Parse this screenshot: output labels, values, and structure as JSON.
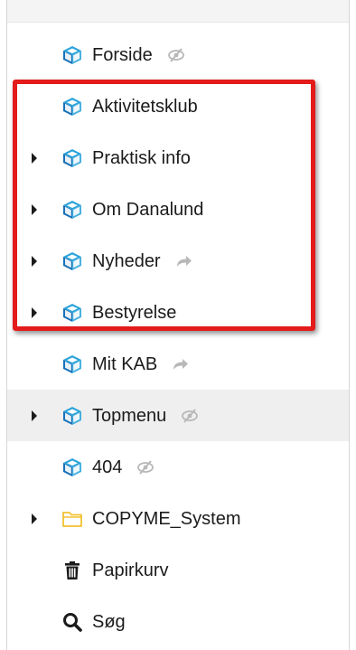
{
  "colors": {
    "cube": "#2aa3d9",
    "cube_dark": "#1671b8",
    "folder": "#f2c12e",
    "text": "#1b1b1b",
    "badge": "#b8b8b8",
    "highlight": "#e31b1b"
  },
  "tree": [
    {
      "label": "Forside",
      "icon": "cube-icon",
      "expandable": false,
      "badge": "eye-slash-icon"
    },
    {
      "label": "Aktivitetsklub",
      "icon": "cube-icon",
      "expandable": false,
      "badge": ""
    },
    {
      "label": "Praktisk info",
      "icon": "cube-icon",
      "expandable": true,
      "badge": ""
    },
    {
      "label": "Om Danalund",
      "icon": "cube-icon",
      "expandable": true,
      "badge": ""
    },
    {
      "label": "Nyheder",
      "icon": "cube-icon",
      "expandable": true,
      "badge": "redirect-arrow-icon"
    },
    {
      "label": "Bestyrelse",
      "icon": "cube-icon",
      "expandable": true,
      "badge": ""
    },
    {
      "label": "Mit KAB",
      "icon": "cube-icon",
      "expandable": false,
      "badge": "redirect-arrow-icon"
    },
    {
      "label": "Topmenu",
      "icon": "cube-icon",
      "expandable": true,
      "badge": "eye-slash-icon",
      "hover": true
    },
    {
      "label": "404",
      "icon": "cube-icon",
      "expandable": false,
      "badge": "eye-slash-icon"
    },
    {
      "label": "COPYME_System",
      "icon": "folder-icon",
      "expandable": true,
      "badge": ""
    },
    {
      "label": "Papirkurv",
      "icon": "trash-icon",
      "expandable": false,
      "badge": ""
    },
    {
      "label": "Søg",
      "icon": "search-icon",
      "expandable": false,
      "badge": ""
    }
  ]
}
